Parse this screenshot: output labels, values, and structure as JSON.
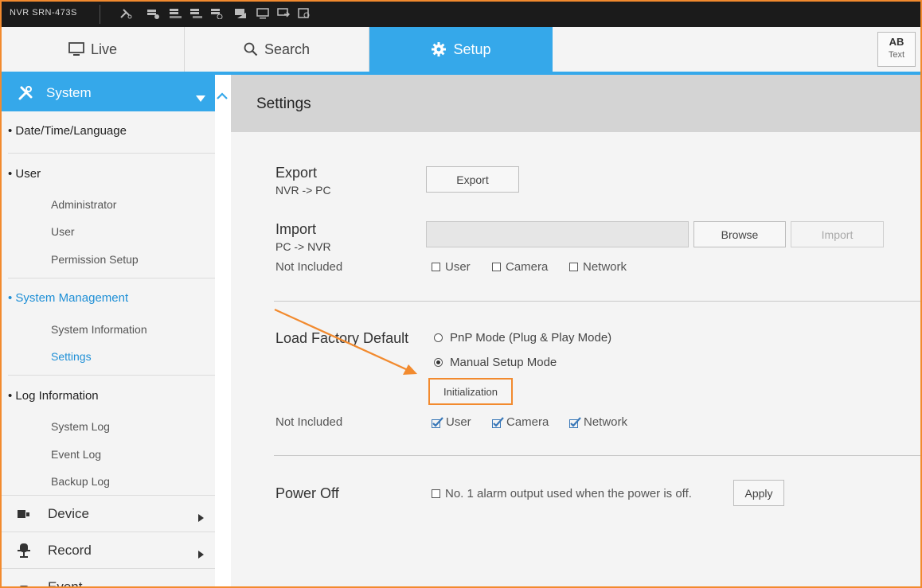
{
  "topbar": {
    "model": "NVR SRN-473S",
    "status_icons": [
      "tools-icon",
      "hdd-info-icon",
      "hdd-full-icon",
      "hdd-none-icon",
      "hdd-overwrite-icon",
      "rec-icon",
      "monitor-icon",
      "network-icon",
      "backup-icon"
    ]
  },
  "tabs": [
    {
      "label": "Live",
      "icon": "monitor-icon",
      "active": false
    },
    {
      "label": "Search",
      "icon": "search-icon",
      "active": false
    },
    {
      "label": "Setup",
      "icon": "gear-icon",
      "active": true
    }
  ],
  "textbox": {
    "abbr": "AB",
    "label": "Text"
  },
  "sidebar": {
    "header": "System",
    "sections": [
      {
        "label": "• Date/Time/Language",
        "items": []
      },
      {
        "label": "• User",
        "items": [
          "Administrator",
          "User",
          "Permission Setup"
        ]
      },
      {
        "label": "• System Management",
        "active": true,
        "items": [
          "System Information",
          "Settings"
        ],
        "active_item": "Settings"
      },
      {
        "label": "• Log Information",
        "items": [
          "System Log",
          "Event Log",
          "Backup Log"
        ]
      }
    ],
    "categories": [
      "Device",
      "Record",
      "Event"
    ]
  },
  "content": {
    "title": "Settings",
    "export": {
      "label": "Export",
      "sub": "NVR -> PC",
      "button": "Export"
    },
    "import": {
      "label": "Import",
      "sub": "PC -> NVR",
      "browse": "Browse",
      "button": "Import",
      "field_value": ""
    },
    "not_included_label": "Not Included",
    "import_not_included": [
      {
        "label": "User",
        "checked": false
      },
      {
        "label": "Camera",
        "checked": false
      },
      {
        "label": "Network",
        "checked": false
      }
    ],
    "factory": {
      "label": "Load Factory Default",
      "options": [
        {
          "label": "PnP Mode (Plug & Play Mode)",
          "selected": false
        },
        {
          "label": "Manual Setup Mode",
          "selected": true
        }
      ],
      "button": "Initialization"
    },
    "factory_not_included": [
      {
        "label": "User",
        "checked": true
      },
      {
        "label": "Camera",
        "checked": true
      },
      {
        "label": "Network",
        "checked": true
      }
    ],
    "power_off": {
      "label": "Power Off",
      "option": "No. 1 alarm output used when the power is off.",
      "checked": false,
      "button": "Apply"
    }
  },
  "colors": {
    "accent": "#35a8ea",
    "annotation": "#f28a2e",
    "active_text": "#1e8fd6"
  }
}
